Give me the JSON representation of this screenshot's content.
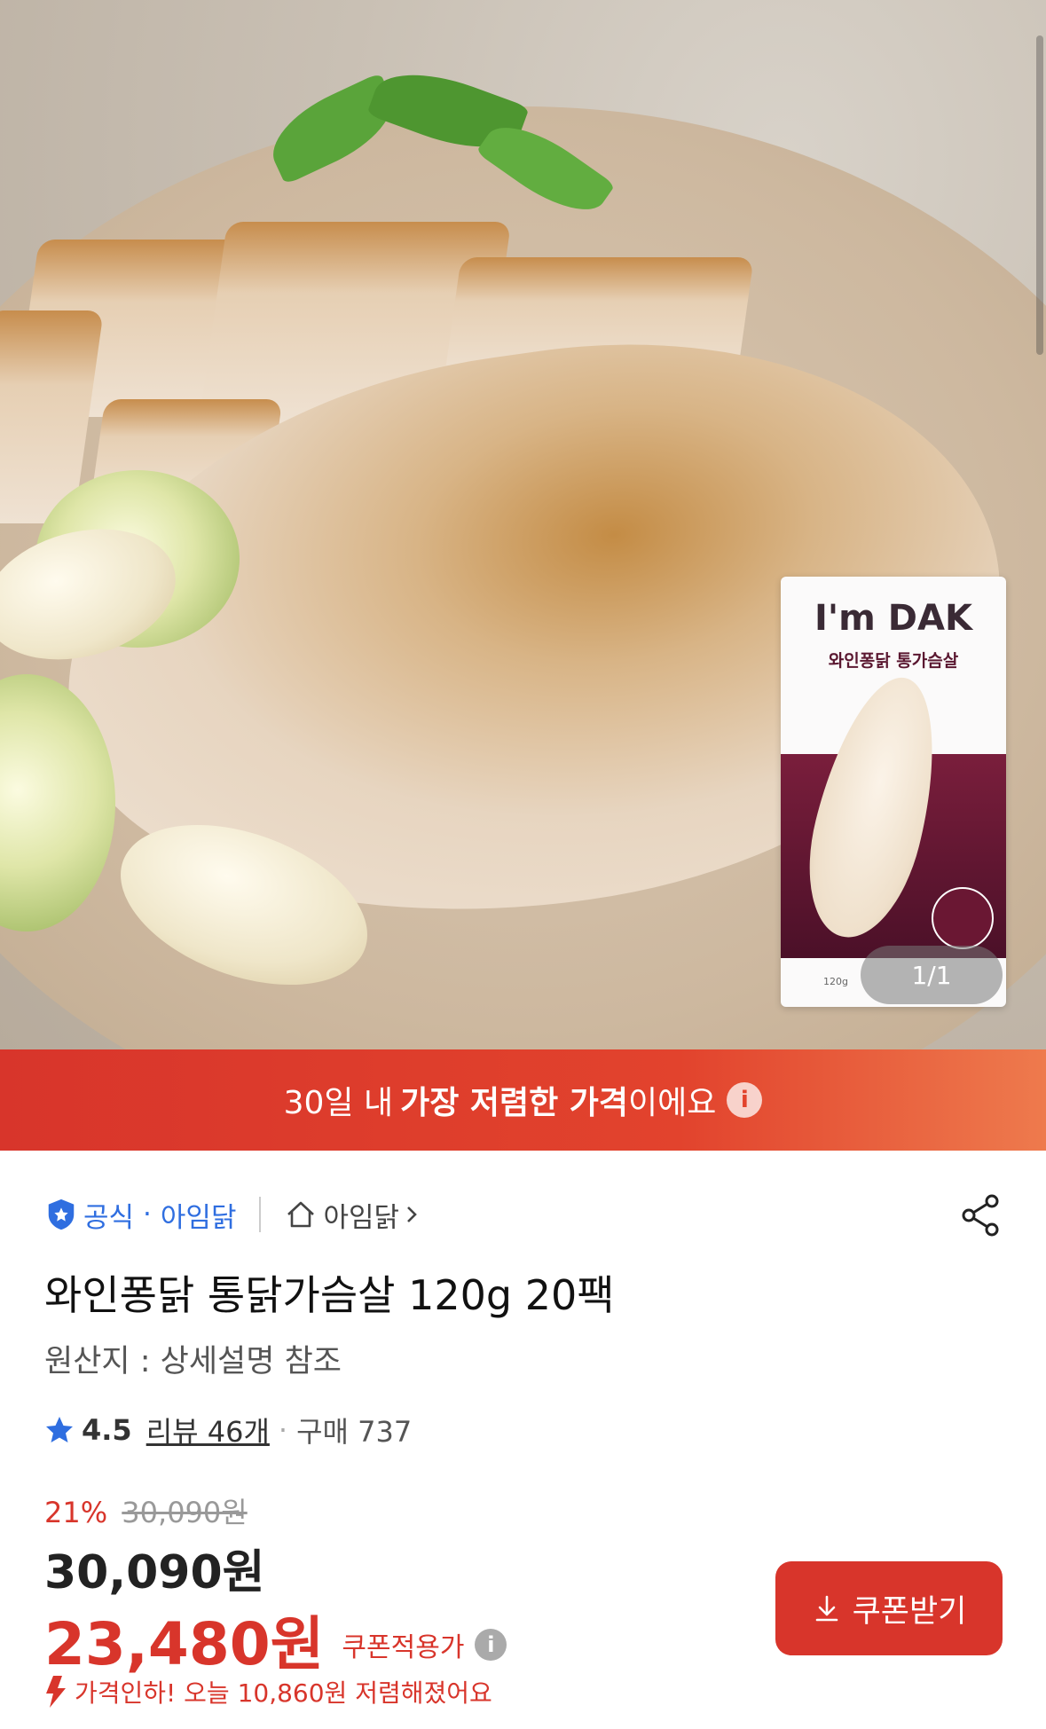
{
  "hero": {
    "image_description": "",
    "counter": "1/1",
    "package": {
      "brand": "I'm DAK",
      "product": "와인퐁닭 통가슴살",
      "fine_print": "120g"
    }
  },
  "banner": {
    "prefix": "30일 내",
    "highlight": "가장 저렴한 가격",
    "suffix": "이에요",
    "info_icon": "info-icon"
  },
  "seller": {
    "official_label": "공식",
    "official_name": "아임닭",
    "store_name": "아임닭"
  },
  "product": {
    "title": "와인퐁닭 통닭가슴살 120g 20팩",
    "origin": "원산지 : 상세설명 참조",
    "rating": "4.5",
    "reviews": "리뷰 46개",
    "purchases": "구매 737"
  },
  "pricing": {
    "discount_pct": "21%",
    "original_price": "30,090원",
    "price": "30,090원",
    "coupon_price": "23,480원",
    "coupon_label": "쿠폰적용가",
    "coupon_button": "쿠폰받기",
    "price_drop": "가격인하! 오늘 10,860원 저렴해졌어요"
  },
  "colors": {
    "accent": "#d8352b",
    "official_blue": "#2f6ee0"
  }
}
